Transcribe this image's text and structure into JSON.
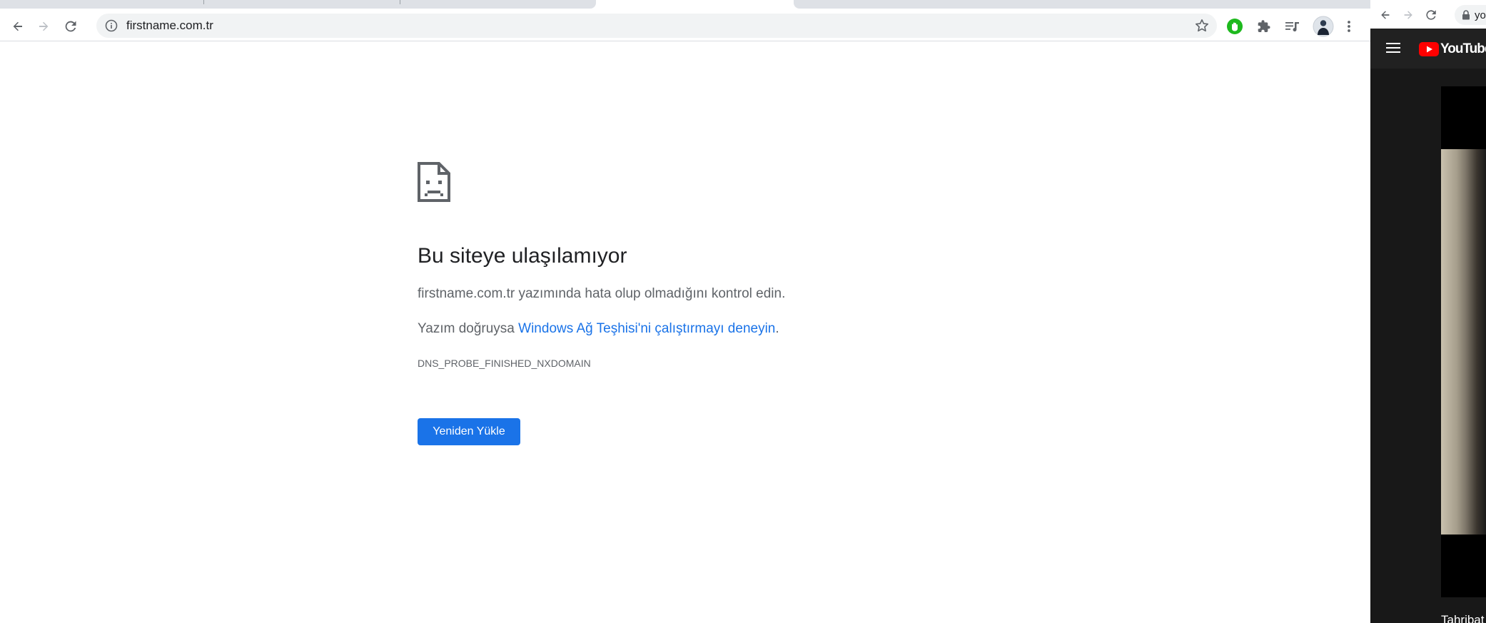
{
  "left_window": {
    "toolbar": {
      "url": "firstname.com.tr"
    },
    "error_page": {
      "title": "Bu siteye ulaşılamıyor",
      "message_1": "firstname.com.tr yazımında hata olup olmadığını kontrol edin.",
      "message_2_prefix": "Yazım doğruysa ",
      "message_2_link": "Windows Ağ Teşhisi'ni çalıştırmayı deneyin",
      "message_2_suffix": ".",
      "error_code": "DNS_PROBE_FINISHED_NXDOMAIN",
      "reload_label": "Yeniden Yükle"
    }
  },
  "right_window": {
    "url_partial": "you",
    "youtube_logo_text": "YouTube",
    "video_title_partial": "Tahribat"
  },
  "colors": {
    "link": "#1a73e8",
    "button_bg": "#1a73e8",
    "text_primary": "#202124",
    "text_secondary": "#5f6368",
    "youtube_red": "#ff0000",
    "youtube_dark": "#212121",
    "extension_green": "#1db91d"
  },
  "icons": [
    "back-icon",
    "forward-icon",
    "reload-icon",
    "info-icon",
    "star-icon",
    "extension-hand-icon",
    "puzzle-icon",
    "media-control-icon",
    "avatar",
    "more-vert-icon",
    "sad-page-icon",
    "lock-icon",
    "hamburger-icon",
    "youtube-logo-icon"
  ]
}
